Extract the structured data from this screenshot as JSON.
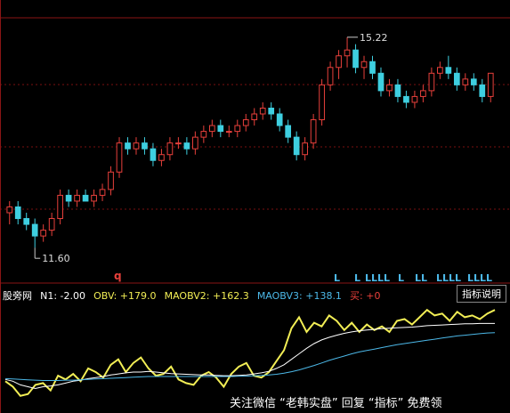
{
  "chart_data": [
    {
      "type": "candlestick",
      "title": "",
      "annotations": {
        "high_label": "15.22",
        "low_label": "11.60",
        "q_marker": "q",
        "buy_flags": "LLLL"
      },
      "candles": [
        {
          "o": 12.2,
          "h": 12.4,
          "l": 12.0,
          "c": 12.3
        },
        {
          "o": 12.3,
          "h": 12.4,
          "l": 12.0,
          "c": 12.1
        },
        {
          "o": 12.1,
          "h": 12.2,
          "l": 11.9,
          "c": 12.0
        },
        {
          "o": 12.0,
          "h": 12.1,
          "l": 11.6,
          "c": 11.8
        },
        {
          "o": 11.8,
          "h": 12.0,
          "l": 11.7,
          "c": 11.9
        },
        {
          "o": 11.9,
          "h": 12.2,
          "l": 11.8,
          "c": 12.1
        },
        {
          "o": 12.1,
          "h": 12.6,
          "l": 12.0,
          "c": 12.5
        },
        {
          "o": 12.5,
          "h": 12.6,
          "l": 12.3,
          "c": 12.4
        },
        {
          "o": 12.4,
          "h": 12.6,
          "l": 12.3,
          "c": 12.5
        },
        {
          "o": 12.5,
          "h": 12.6,
          "l": 12.4,
          "c": 12.4
        },
        {
          "o": 12.4,
          "h": 12.6,
          "l": 12.3,
          "c": 12.5
        },
        {
          "o": 12.5,
          "h": 12.7,
          "l": 12.4,
          "c": 12.6
        },
        {
          "o": 12.6,
          "h": 13.0,
          "l": 12.5,
          "c": 12.9
        },
        {
          "o": 12.9,
          "h": 13.5,
          "l": 12.8,
          "c": 13.4
        },
        {
          "o": 13.4,
          "h": 13.5,
          "l": 13.2,
          "c": 13.3
        },
        {
          "o": 13.3,
          "h": 13.5,
          "l": 13.2,
          "c": 13.4
        },
        {
          "o": 13.4,
          "h": 13.5,
          "l": 13.2,
          "c": 13.3
        },
        {
          "o": 13.3,
          "h": 13.4,
          "l": 13.0,
          "c": 13.1
        },
        {
          "o": 13.1,
          "h": 13.3,
          "l": 13.0,
          "c": 13.2
        },
        {
          "o": 13.2,
          "h": 13.5,
          "l": 13.1,
          "c": 13.4
        },
        {
          "o": 13.4,
          "h": 13.5,
          "l": 13.3,
          "c": 13.4
        },
        {
          "o": 13.4,
          "h": 13.5,
          "l": 13.2,
          "c": 13.3
        },
        {
          "o": 13.3,
          "h": 13.6,
          "l": 13.2,
          "c": 13.5
        },
        {
          "o": 13.5,
          "h": 13.7,
          "l": 13.4,
          "c": 13.6
        },
        {
          "o": 13.6,
          "h": 13.8,
          "l": 13.5,
          "c": 13.7
        },
        {
          "o": 13.7,
          "h": 13.8,
          "l": 13.5,
          "c": 13.6
        },
        {
          "o": 13.6,
          "h": 13.7,
          "l": 13.5,
          "c": 13.6
        },
        {
          "o": 13.6,
          "h": 13.8,
          "l": 13.5,
          "c": 13.7
        },
        {
          "o": 13.7,
          "h": 13.9,
          "l": 13.6,
          "c": 13.8
        },
        {
          "o": 13.8,
          "h": 14.0,
          "l": 13.7,
          "c": 13.9
        },
        {
          "o": 13.9,
          "h": 14.1,
          "l": 13.8,
          "c": 14.0
        },
        {
          "o": 14.0,
          "h": 14.1,
          "l": 13.8,
          "c": 13.9
        },
        {
          "o": 13.9,
          "h": 14.0,
          "l": 13.6,
          "c": 13.7
        },
        {
          "o": 13.7,
          "h": 13.8,
          "l": 13.4,
          "c": 13.5
        },
        {
          "o": 13.5,
          "h": 13.6,
          "l": 13.1,
          "c": 13.2
        },
        {
          "o": 13.2,
          "h": 13.5,
          "l": 13.1,
          "c": 13.4
        },
        {
          "o": 13.4,
          "h": 13.9,
          "l": 13.3,
          "c": 13.8
        },
        {
          "o": 13.8,
          "h": 14.5,
          "l": 13.7,
          "c": 14.4
        },
        {
          "o": 14.4,
          "h": 14.8,
          "l": 14.3,
          "c": 14.7
        },
        {
          "o": 14.7,
          "h": 15.0,
          "l": 14.5,
          "c": 14.9
        },
        {
          "o": 14.9,
          "h": 15.22,
          "l": 14.7,
          "c": 15.0
        },
        {
          "o": 15.0,
          "h": 15.1,
          "l": 14.6,
          "c": 14.7
        },
        {
          "o": 14.7,
          "h": 14.9,
          "l": 14.5,
          "c": 14.8
        },
        {
          "o": 14.8,
          "h": 14.9,
          "l": 14.5,
          "c": 14.6
        },
        {
          "o": 14.6,
          "h": 14.7,
          "l": 14.2,
          "c": 14.3
        },
        {
          "o": 14.3,
          "h": 14.5,
          "l": 14.2,
          "c": 14.4
        },
        {
          "o": 14.4,
          "h": 14.5,
          "l": 14.1,
          "c": 14.2
        },
        {
          "o": 14.2,
          "h": 14.3,
          "l": 14.0,
          "c": 14.1
        },
        {
          "o": 14.1,
          "h": 14.3,
          "l": 14.0,
          "c": 14.2
        },
        {
          "o": 14.2,
          "h": 14.4,
          "l": 14.1,
          "c": 14.3
        },
        {
          "o": 14.3,
          "h": 14.7,
          "l": 14.2,
          "c": 14.6
        },
        {
          "o": 14.6,
          "h": 14.8,
          "l": 14.5,
          "c": 14.7
        },
        {
          "o": 14.7,
          "h": 14.9,
          "l": 14.5,
          "c": 14.6
        },
        {
          "o": 14.6,
          "h": 14.7,
          "l": 14.3,
          "c": 14.4
        },
        {
          "o": 14.4,
          "h": 14.6,
          "l": 14.3,
          "c": 14.5
        },
        {
          "o": 14.5,
          "h": 14.6,
          "l": 14.3,
          "c": 14.4
        },
        {
          "o": 14.4,
          "h": 14.5,
          "l": 14.1,
          "c": 14.2
        },
        {
          "o": 14.2,
          "h": 14.6,
          "l": 14.1,
          "c": 14.6
        }
      ],
      "colors": {
        "up": "#e8403b",
        "down": "#3ecfe0"
      }
    },
    {
      "type": "line",
      "title": "",
      "ylim": [
        -60,
        220
      ],
      "series": [
        {
          "name": "OBV",
          "color": "#f2ee55",
          "values": [
            5,
            -10,
            -35,
            -30,
            -5,
            0,
            -20,
            20,
            10,
            25,
            5,
            40,
            30,
            15,
            50,
            65,
            30,
            55,
            70,
            40,
            20,
            25,
            45,
            10,
            0,
            -5,
            20,
            30,
            15,
            -10,
            25,
            45,
            55,
            20,
            15,
            30,
            60,
            90,
            150,
            180,
            140,
            165,
            155,
            185,
            170,
            145,
            165,
            140,
            160,
            145,
            155,
            140,
            170,
            175,
            160,
            180,
            200,
            185,
            190,
            170,
            195,
            180,
            185,
            175,
            190,
            200
          ]
        },
        {
          "name": "MAOBV2",
          "color": "#ffffff",
          "values": [
            10,
            5,
            -5,
            -10,
            -15,
            -10,
            -8,
            -5,
            0,
            5,
            8,
            12,
            15,
            18,
            22,
            25,
            28,
            30,
            30,
            32,
            30,
            28,
            26,
            25,
            24,
            23,
            22,
            22,
            21,
            20,
            20,
            21,
            22,
            25,
            28,
            32,
            40,
            50,
            65,
            80,
            95,
            108,
            118,
            125,
            131,
            136,
            140,
            143,
            145,
            147,
            149,
            150,
            151,
            152,
            153,
            155,
            157,
            158,
            159,
            160,
            161,
            162,
            162,
            163,
            163,
            163
          ]
        },
        {
          "name": "MAOBV3",
          "color": "#4cb8e8",
          "values": [
            12,
            11,
            10,
            9,
            8,
            7,
            7,
            7,
            8,
            8,
            9,
            10,
            11,
            12,
            13,
            14,
            15,
            16,
            17,
            18,
            18,
            18,
            18,
            18,
            18,
            18,
            18,
            18,
            18,
            18,
            18,
            19,
            19,
            20,
            21,
            22,
            24,
            27,
            31,
            36,
            42,
            48,
            55,
            62,
            68,
            74,
            80,
            85,
            89,
            93,
            97,
            101,
            105,
            108,
            111,
            114,
            117,
            120,
            123,
            126,
            129,
            131,
            133,
            135,
            137,
            138
          ]
        }
      ],
      "legend": {
        "name": "股旁网",
        "n1": "N1: -2.00",
        "obv": "OBV: +179.0",
        "maobv2": "MAOBV2: +162.3",
        "maobv3": "MAOBV3: +138.1",
        "buy": "买: +0"
      }
    }
  ],
  "ui": {
    "explain_button": "指标说明",
    "footer_text": "关注微信 “老韩实盘” 回复 “指标” 免费领"
  }
}
